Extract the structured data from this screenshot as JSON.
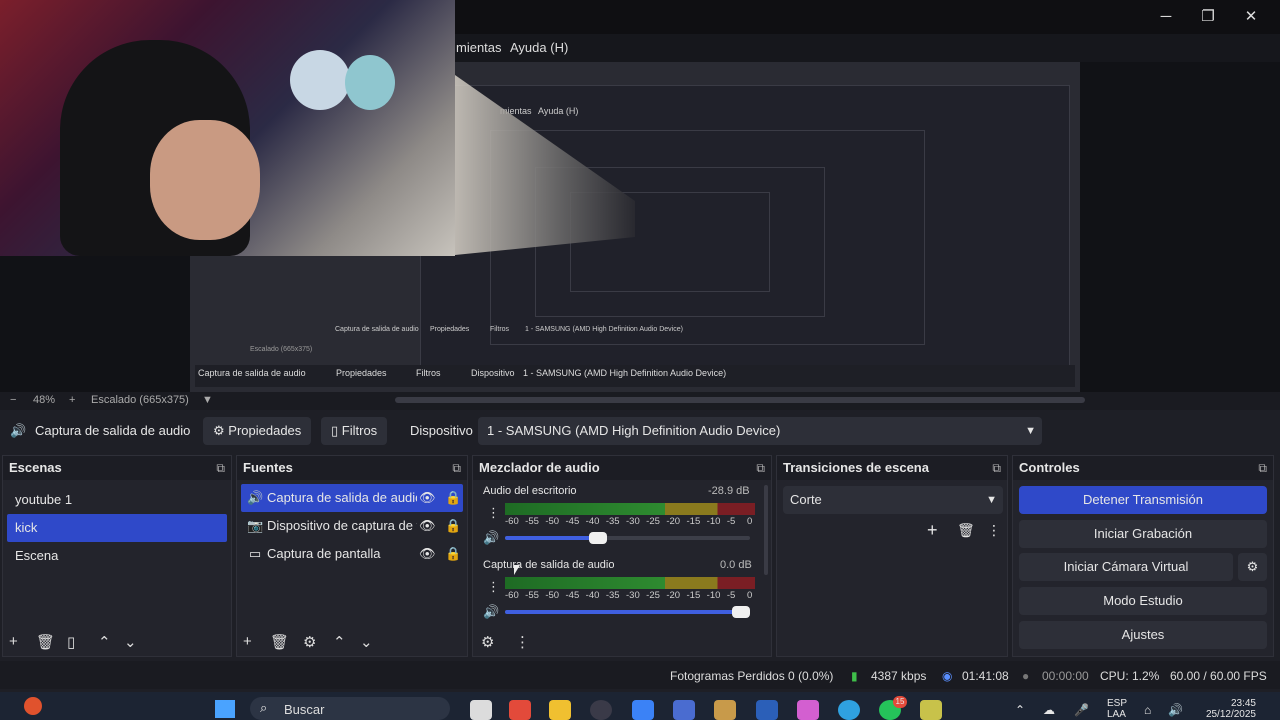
{
  "menu": {
    "tools_partial": "mientas",
    "help": "Ayuda (H)"
  },
  "window_buttons": {
    "minimize": "─",
    "maximize": "❐",
    "close": "✕"
  },
  "preview": {
    "zoom": "48%",
    "scaling": "Escalado (665x375)",
    "nested_labels": {
      "source": "Captura de salida de audio",
      "properties": "Propiedades",
      "filters": "Filtros",
      "device_label": "Dispositivo",
      "device": "1 - SAMSUNG (AMD High Definition Audio Device)",
      "help": "Ayuda (H)",
      "tools_partial": "mientas"
    }
  },
  "source_toolbar": {
    "source_name": "Captura de salida de audio",
    "properties": "Propiedades",
    "filters": "Filtros",
    "device_label": "Dispositivo",
    "device_value": "1 - SAMSUNG (AMD High Definition Audio Device)"
  },
  "scenes": {
    "title": "Escenas",
    "items": [
      "youtube 1",
      "kick",
      "Escena"
    ]
  },
  "sources": {
    "title": "Fuentes",
    "items": [
      {
        "label": "Captura de salida de audic",
        "icon": "speaker-icon"
      },
      {
        "label": "Dispositivo de captura de v",
        "icon": "camera-icon"
      },
      {
        "label": "Captura de pantalla",
        "icon": "monitor-icon"
      }
    ]
  },
  "mixer": {
    "title": "Mezclador de audio",
    "channels": [
      {
        "name": "Audio del escritorio",
        "db": "-28.9 dB",
        "volume": 0.38
      },
      {
        "name": "Captura de salida de audio",
        "db": "0.0 dB",
        "volume": 1.0
      }
    ],
    "scale": [
      "-60",
      "-55",
      "-50",
      "-45",
      "-40",
      "-35",
      "-30",
      "-25",
      "-20",
      "-15",
      "-10",
      "-5",
      "0"
    ]
  },
  "transitions": {
    "title": "Transiciones de escena",
    "selected": "Corte"
  },
  "controls": {
    "title": "Controles",
    "stop_stream": "Detener Transmisión",
    "start_recording": "Iniciar Grabación",
    "start_virtual_cam": "Iniciar Cámara Virtual",
    "studio_mode": "Modo Estudio",
    "settings": "Ajustes"
  },
  "status": {
    "dropped_frames": "Fotogramas Perdidos 0 (0.0%)",
    "bitrate": "4387 kbps",
    "stream_time": "01:41:08",
    "rec_time": "00:00:00",
    "cpu": "CPU: 1.2%",
    "fps": "60.00 / 60.00 FPS"
  },
  "taskbar": {
    "search": "Buscar",
    "lang": "ESP",
    "lang_sub": "LAA",
    "time": "23:45",
    "date": "25/12/2025",
    "badge": "15"
  },
  "colors": {
    "accent": "#2f49c9",
    "bg": "#1e1f26"
  }
}
